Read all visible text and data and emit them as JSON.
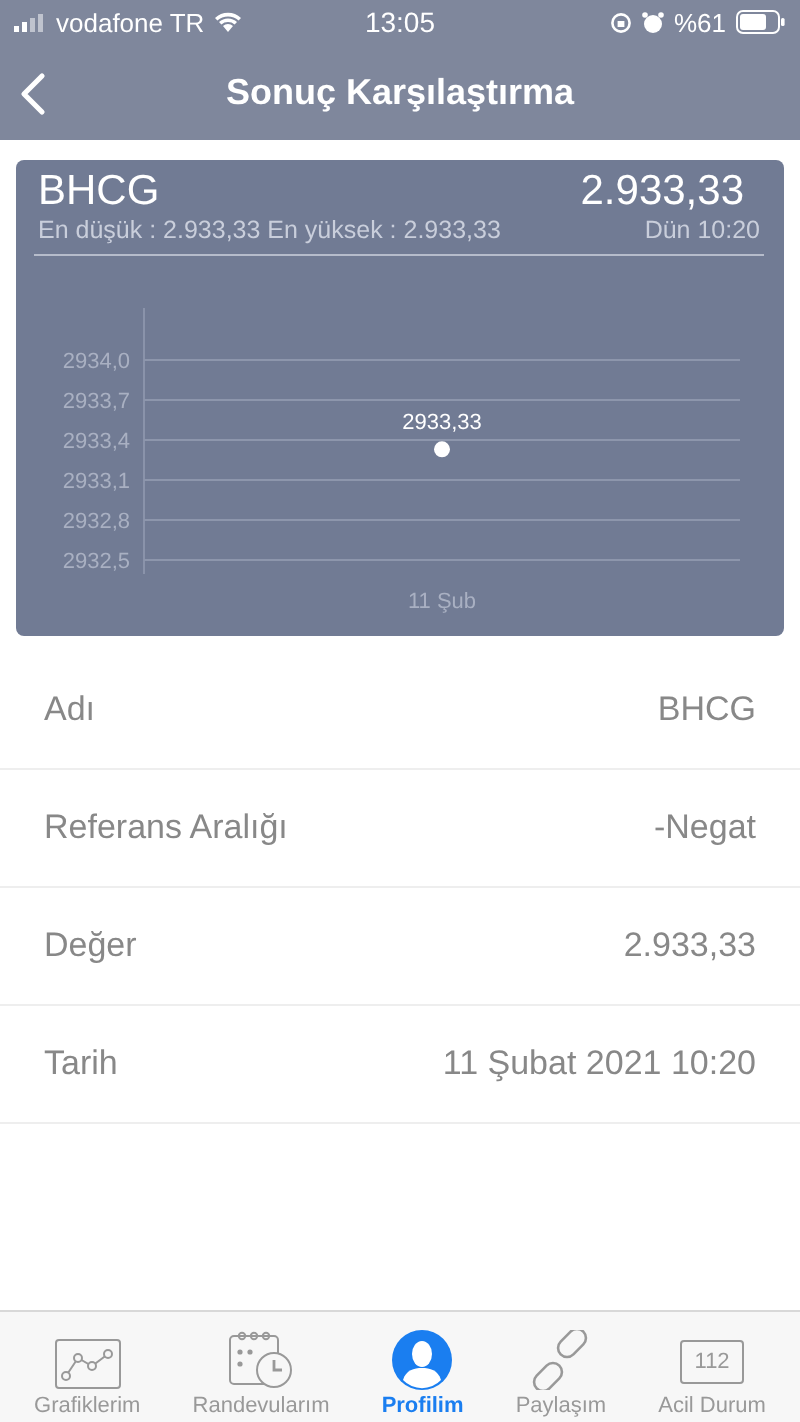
{
  "status_bar": {
    "carrier": "vodafone TR",
    "time": "13:05",
    "battery": "%61"
  },
  "nav": {
    "title": "Sonuç Karşılaştırma"
  },
  "summary": {
    "name": "BHCG",
    "value": "2.933,33",
    "range": "En düşük : 2.933,33 En yüksek : 2.933,33",
    "time": "Dün 10:20",
    "chart_data": {
      "type": "scatter",
      "x": [
        "11 Şub"
      ],
      "values": [
        2933.33
      ],
      "ylim": [
        2932.5,
        2934.0
      ],
      "yticks": [
        {
          "value": 2932.5,
          "label": "2932,5"
        },
        {
          "value": 2932.8,
          "label": "2932,8"
        },
        {
          "value": 2933.1,
          "label": "2933,1"
        },
        {
          "value": 2933.4,
          "label": "2933,4"
        },
        {
          "value": 2933.7,
          "label": "2933,7"
        },
        {
          "value": 2934.0,
          "label": "2934,0"
        }
      ],
      "value_labels": [
        "2933,33"
      ],
      "grid": true
    }
  },
  "details": [
    {
      "label": "Adı",
      "value": "BHCG"
    },
    {
      "label": "Referans Aralığı",
      "value": "-Negat"
    },
    {
      "label": "Değer",
      "value": "2.933,33"
    },
    {
      "label": "Tarih",
      "value": "11 Şubat 2021 10:20"
    }
  ],
  "tabs": [
    {
      "kind": "chart",
      "label": "Grafiklerim",
      "selected": false
    },
    {
      "kind": "calendar",
      "label": "Randevularım",
      "selected": false
    },
    {
      "kind": "profile",
      "label": "Profilim",
      "selected": true
    },
    {
      "kind": "link",
      "label": "Paylaşım",
      "selected": false
    },
    {
      "kind": "emergency",
      "label": "Acil Durum",
      "icon_text": "112",
      "selected": false
    }
  ]
}
